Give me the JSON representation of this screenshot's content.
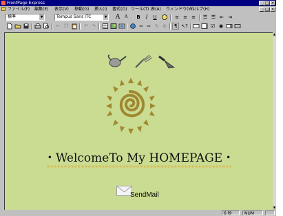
{
  "window": {
    "title": "FrontPage Express"
  },
  "menu": {
    "items": [
      "ファイル(F)",
      "編集(E)",
      "表示(V)",
      "移動(G)",
      "挿入(I)",
      "書式(O)",
      "ツール(T)",
      "表(A)",
      "ウィンドウ(W)",
      "ヘルプ(H)"
    ]
  },
  "formatting": {
    "style": "標準",
    "font": "Tempus Sans ITC"
  },
  "page": {
    "heading": "・WelcomeTo My HOMEPAGE・",
    "sendmail_label": "SendMail"
  },
  "status": {
    "time": "6 秒",
    "num": "NUM"
  },
  "colors": {
    "page_background": "#c9dc92",
    "title_bar": "#000080",
    "sun": "#a08830"
  }
}
